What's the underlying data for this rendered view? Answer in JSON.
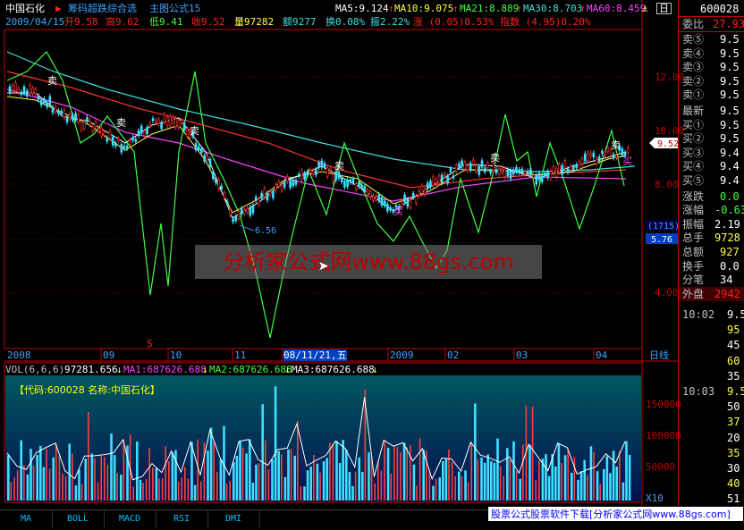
{
  "header": {
    "stock_name": "中国石化",
    "indicator_name": "筹码超跌综合选",
    "formula": "主图公式15",
    "ma5": "MA5:9.124",
    "ma10": "MA10:9.075",
    "ma21": "MA21:8.889",
    "ma30": "MA30:8.703",
    "ma60": "MA60:8.459",
    "ma_arrow_up": "↑",
    "ma_arrow_down": "↓"
  },
  "info": {
    "date": "2009/04/15",
    "open": "开9.58",
    "high": "高9.62",
    "low": "低9.41",
    "close": "收9.52",
    "volume": "量97282",
    "amount": "额9277",
    "turnover": "换0.08%",
    "amplitude": "振2.22%",
    "change": "涨 (0.05)0.53%",
    "index": "指数 (4.95)0.20%"
  },
  "price_axis": [
    "12.00",
    "10.00",
    "8.00",
    "6.00",
    "4.00"
  ],
  "price_tags": {
    "current": "9.52",
    "count": "(1715)",
    "count_value": "5.76",
    "low_label": "6.56"
  },
  "signals": {
    "sell": "卖",
    "buy": "买",
    "s": "S"
  },
  "time_axis": [
    {
      "label": "2008"
    },
    {
      "label": "09"
    },
    {
      "label": "10"
    },
    {
      "label": "11"
    },
    {
      "label": "08/11/21,五"
    },
    {
      "label": "2009"
    },
    {
      "label": "02"
    },
    {
      "label": "03"
    },
    {
      "label": "04"
    }
  ],
  "period": "日线",
  "volume_panel": {
    "title": "VOL(6,6,6)",
    "vol": "97281.656",
    "ma1": "MA1:687626.688",
    "ma2": "MA2:687626.688",
    "ma3": "MA3:687626.688",
    "legend": "【代码:600028 名称:中国石化】",
    "axis": [
      "150000",
      "100000",
      "50000"
    ],
    "unit": "X10"
  },
  "right_panel": {
    "code": "600028",
    "weibi_label": "委比",
    "weibi_value": "27.93",
    "rows": [
      {
        "label": "卖⑤",
        "value": "9.5"
      },
      {
        "label": "卖④",
        "value": "9.5"
      },
      {
        "label": "卖③",
        "value": "9.5"
      },
      {
        "label": "卖②",
        "value": "9.5"
      },
      {
        "label": "卖①",
        "value": "9.5"
      },
      {
        "label": "最新",
        "value": "9.5"
      },
      {
        "label": "买①",
        "value": "9.5"
      },
      {
        "label": "买②",
        "value": "9.5"
      },
      {
        "label": "买③",
        "value": "9.4"
      },
      {
        "label": "买④",
        "value": "9.4"
      },
      {
        "label": "买⑤",
        "value": "9.4"
      },
      {
        "label": "涨跌",
        "value": "0.0"
      },
      {
        "label": "涨幅",
        "value": "-0.63"
      },
      {
        "label": "振幅",
        "value": "2.19"
      },
      {
        "label": "总手",
        "value": "9728"
      },
      {
        "label": "总额",
        "value": "927"
      },
      {
        "label": "换手",
        "value": "0.0"
      },
      {
        "label": "分笔",
        "value": "34"
      },
      {
        "label": "外盘",
        "value": "2942"
      }
    ],
    "ticks": [
      {
        "time": "10:02",
        "value": "9.5"
      },
      {
        "time": "",
        "value": "95"
      },
      {
        "time": "",
        "value": "45"
      },
      {
        "time": "",
        "value": "60"
      },
      {
        "time": "",
        "value": "35"
      },
      {
        "time": "10:03",
        "value": "9.5"
      },
      {
        "time": "",
        "value": "50"
      },
      {
        "time": "",
        "value": "37"
      },
      {
        "time": "",
        "value": "20"
      },
      {
        "time": "",
        "value": "35"
      },
      {
        "time": "",
        "value": "30"
      },
      {
        "time": "",
        "value": "40"
      },
      {
        "time": "",
        "value": "51"
      }
    ]
  },
  "tabs": [
    "MA",
    "BOLL",
    "MACD",
    "RSI",
    "DMI"
  ],
  "watermark": "分析家公式网www.88gs.com",
  "ad_text": "股票公式股票软件下载[分析家公式网www.88gs.com]"
}
